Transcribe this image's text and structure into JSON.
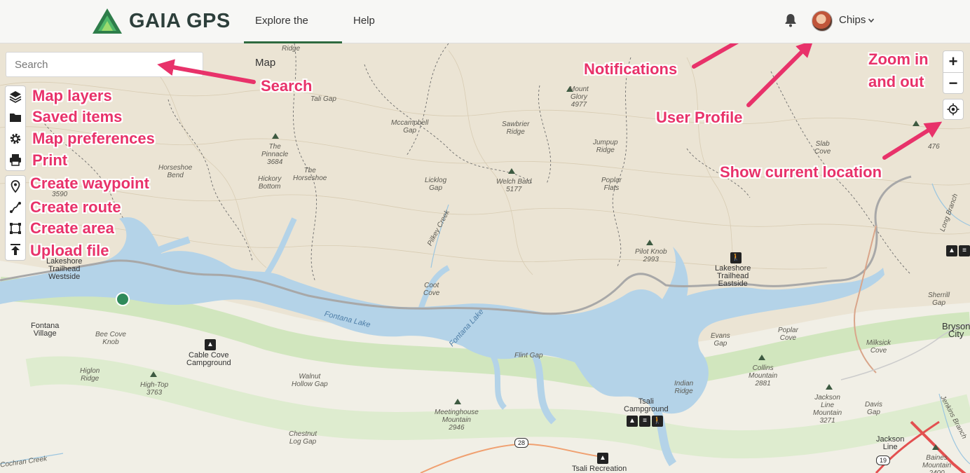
{
  "header": {
    "logo_text": "GAIA GPS",
    "nav": {
      "explore": "Explore the Map",
      "help": "Help"
    },
    "user": {
      "name": "Chips"
    }
  },
  "search": {
    "placeholder": "Search"
  },
  "toolbar": {
    "icons": [
      "layers-icon",
      "folder-icon",
      "gear-icon",
      "printer-icon",
      "waypoint-pin-icon",
      "route-icon",
      "area-icon",
      "upload-icon"
    ]
  },
  "zoom": {
    "in": "+",
    "out": "−"
  },
  "annotations": {
    "search": "Search",
    "map_layers": "Map layers",
    "saved_items": "Saved items",
    "map_preferences": "Map preferences",
    "print": "Print",
    "create_waypoint": "Create waypoint",
    "create_route": "Create route",
    "create_area": "Create area",
    "upload_file": "Upload file",
    "notifications": "Notifications",
    "user_profile": "User Profile",
    "zoom_line1": "Zoom in",
    "zoom_line2": "and out",
    "show_location": "Show current location",
    "color": "#e8326a"
  },
  "map": {
    "places": [
      {
        "id": "ridge-top",
        "lines": [
          "Ridge"
        ]
      },
      {
        "id": "tali-gap",
        "lines": [
          "Tali Gap"
        ]
      },
      {
        "id": "mount-glory",
        "lines": [
          "Mount",
          "Glory",
          "4977"
        ]
      },
      {
        "id": "mccampbell-gap",
        "lines": [
          "Mccampbell",
          "Gap"
        ]
      },
      {
        "id": "sawbrier-ridge",
        "lines": [
          "Sawbrier",
          "Ridge"
        ]
      },
      {
        "id": "jumpup-ridge",
        "lines": [
          "Jumpup",
          "Ridge"
        ]
      },
      {
        "id": "slab-cove",
        "lines": [
          "Slab",
          "Cove"
        ]
      },
      {
        "id": "the-pinnacle",
        "lines": [
          "The",
          "Pinnacle",
          "3684"
        ]
      },
      {
        "id": "horseshoe-bend",
        "lines": [
          "Horseshoe",
          "Bend"
        ]
      },
      {
        "id": "hickory-bottom",
        "lines": [
          "Hickory",
          "Bottom"
        ]
      },
      {
        "id": "the-horseshoe",
        "lines": [
          "The",
          "Horseshoe"
        ]
      },
      {
        "id": "licklog-gap",
        "lines": [
          "Licklog",
          "Gap"
        ]
      },
      {
        "id": "welch-bald",
        "lines": [
          "Welch Bald",
          "5177"
        ]
      },
      {
        "id": "poplar-flats",
        "lines": [
          "Poplar",
          "Flats"
        ]
      },
      {
        "id": "pilot-knob",
        "lines": [
          "Pilot Knob",
          "2993"
        ]
      },
      {
        "id": "pilkey-creek",
        "lines": [
          "Pilkey Creek"
        ]
      },
      {
        "id": "coot-cove",
        "lines": [
          "Coot",
          "Cove"
        ]
      },
      {
        "id": "num-3590",
        "lines": [
          "3590"
        ]
      },
      {
        "id": "long-branch",
        "lines": [
          "Long Branch"
        ]
      },
      {
        "id": "sherrill-gap",
        "lines": [
          "Sherrill",
          "Gap"
        ]
      },
      {
        "id": "poplar-cove",
        "lines": [
          "Poplar",
          "Cove"
        ]
      },
      {
        "id": "evans-gap",
        "lines": [
          "Evans",
          "Gap"
        ]
      },
      {
        "id": "milksick-cove",
        "lines": [
          "Milksick",
          "Cove"
        ]
      },
      {
        "id": "collins-mountain",
        "lines": [
          "Collins",
          "Mountain",
          "2881"
        ]
      },
      {
        "id": "flint-gap",
        "lines": [
          "Flint Gap"
        ]
      },
      {
        "id": "indian-ridge",
        "lines": [
          "Indian",
          "Ridge"
        ]
      },
      {
        "id": "bee-cove-knob",
        "lines": [
          "Bee Cove",
          "Knob"
        ]
      },
      {
        "id": "higlon-ridge",
        "lines": [
          "Higlon",
          "Ridge"
        ]
      },
      {
        "id": "high-top",
        "lines": [
          "High-Top",
          "3763"
        ]
      },
      {
        "id": "walnut-hollow-gap",
        "lines": [
          "Walnut",
          "Hollow Gap"
        ]
      },
      {
        "id": "meetinghouse-mountain",
        "lines": [
          "Meetinghouse",
          "Mountain",
          "2946"
        ]
      },
      {
        "id": "chestnut-log-gap",
        "lines": [
          "Chestnut",
          "Log Gap"
        ]
      },
      {
        "id": "jackson-line-mountain",
        "lines": [
          "Jackson",
          "Line",
          "Mountain",
          "3271"
        ]
      },
      {
        "id": "davis-gap",
        "lines": [
          "Davis",
          "Gap"
        ]
      },
      {
        "id": "baines-mountain",
        "lines": [
          "Baines",
          "Mountain",
          "2400"
        ]
      },
      {
        "id": "cochran-creek",
        "lines": [
          "Cochran Creek"
        ]
      },
      {
        "id": "jenkins-branch",
        "lines": [
          "Jenkins Branch"
        ]
      },
      {
        "id": "cove-476",
        "lines": [
          "476"
        ]
      }
    ],
    "dark_places": [
      {
        "id": "lakeshore-trailhead-westside",
        "lines": [
          "Lakeshore",
          "Trailhead",
          "Westside"
        ]
      },
      {
        "id": "lakeshore-trailhead-eastside",
        "lines": [
          "Lakeshore",
          "Trailhead",
          "Eastside"
        ]
      },
      {
        "id": "fontana-village",
        "lines": [
          "Fontana",
          "Village"
        ]
      },
      {
        "id": "cable-cove-campground",
        "lines": [
          "Cable Cove",
          "Campground"
        ]
      },
      {
        "id": "tsali-campground",
        "lines": [
          "Tsali",
          "Campground"
        ]
      },
      {
        "id": "tsali-recreation",
        "lines": [
          "Tsali Recreation"
        ]
      },
      {
        "id": "bryson-city",
        "lines": [
          "Bryson",
          "City"
        ]
      },
      {
        "id": "jackson-line",
        "lines": [
          "Jackson",
          "Line"
        ]
      }
    ],
    "lake_labels": [
      "Fontana Lake",
      "Fontana Lake"
    ],
    "shields": [
      "28",
      "19"
    ]
  }
}
